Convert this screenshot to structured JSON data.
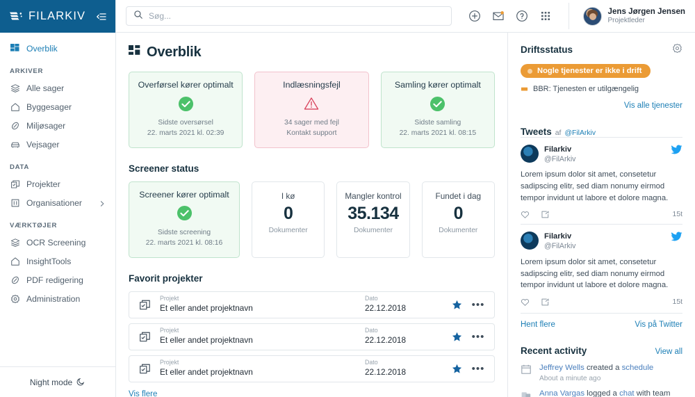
{
  "brand": {
    "name": "FILARKIV",
    "logo_icon": "filarkiv-logo-icon",
    "collapse_icon": "collapse-sidebar-icon"
  },
  "sidebar": {
    "primary": [
      {
        "label": "Overblik",
        "icon": "dashboard-icon",
        "active": true
      }
    ],
    "sections": [
      {
        "title": "ARKIVER",
        "items": [
          {
            "label": "Alle sager",
            "icon": "layers-icon"
          },
          {
            "label": "Byggesager",
            "icon": "home-icon"
          },
          {
            "label": "Miljøsager",
            "icon": "leaf-icon"
          },
          {
            "label": "Vejsager",
            "icon": "car-icon"
          }
        ]
      },
      {
        "title": "DATA",
        "items": [
          {
            "label": "Projekter",
            "icon": "copy-icon"
          },
          {
            "label": "Organisationer",
            "icon": "building-icon",
            "chevron": "chevron-right-icon"
          }
        ]
      },
      {
        "title": "VÆRKTØJER",
        "items": [
          {
            "label": "OCR Screening",
            "icon": "layers-icon"
          },
          {
            "label": "InsightTools",
            "icon": "home-icon"
          },
          {
            "label": "PDF redigering",
            "icon": "leaf-icon"
          },
          {
            "label": "Administration",
            "icon": "gear-icon"
          }
        ]
      }
    ],
    "night_mode": {
      "label": "Night mode",
      "icon": "moon-icon"
    }
  },
  "topbar": {
    "search": {
      "placeholder": "Søg...",
      "value": "",
      "icon": "search-icon"
    },
    "icons": [
      {
        "name": "add-circle-icon"
      },
      {
        "name": "mail-icon"
      },
      {
        "name": "help-circle-icon"
      },
      {
        "name": "apps-grid-icon"
      }
    ],
    "profile": {
      "name": "Jens Jørgen Jensen",
      "role": "Projektleder",
      "avatar": "user-avatar"
    }
  },
  "page": {
    "title": "Overblik",
    "title_icon": "dashboard-icon",
    "settings_icon": "gear-icon"
  },
  "status_cards": [
    {
      "title": "Overførsel kører optimalt",
      "state": "ok",
      "icon": "check-circle-icon",
      "sub1": "Sidste oversørsel",
      "sub2": "22. marts 2021 kl. 02:39"
    },
    {
      "title": "Indlæsningsfejl",
      "state": "error",
      "icon": "warning-triangle-icon",
      "sub1": "34 sager med fejl",
      "sub2": "Kontakt support"
    },
    {
      "title": "Samling kører optimalt",
      "state": "ok",
      "icon": "check-circle-icon",
      "sub1": "Sidste samling",
      "sub2": "22. marts 2021 kl. 08:15"
    }
  ],
  "screener": {
    "heading": "Screener status",
    "status_card": {
      "title": "Screener kører optimalt",
      "icon": "check-circle-icon",
      "sub1": "Sidste screening",
      "sub2": "22. marts 2021 kl. 08:16"
    },
    "metrics": [
      {
        "label": "I kø",
        "value": "0",
        "unit": "Dokumenter"
      },
      {
        "label": "Mangler kontrol",
        "value": "35.134",
        "unit": "Dokumenter"
      },
      {
        "label": "Fundet i dag",
        "value": "0",
        "unit": "Dokumenter"
      }
    ]
  },
  "favorites": {
    "heading": "Favorit projekter",
    "col_project_label": "Projekt",
    "col_date_label": "Dato",
    "rows": [
      {
        "project": "Et eller andet projektnavn",
        "date": "22.12.2018",
        "icon": "project-copy-icon",
        "star": "star-filled-icon",
        "more": "more-horizontal-icon"
      },
      {
        "project": "Et eller andet projektnavn",
        "date": "22.12.2018",
        "icon": "project-copy-icon",
        "star": "star-filled-icon",
        "more": "more-horizontal-icon"
      },
      {
        "project": "Et eller andet projektnavn",
        "date": "22.12.2018",
        "icon": "project-copy-icon",
        "star": "star-filled-icon",
        "more": "more-horizontal-icon"
      }
    ],
    "show_more": "Vis flere"
  },
  "driftsstatus": {
    "heading": "Driftsstatus",
    "badge": "Nogle tjenester er ikke i drift",
    "badge_color": "#eb9b35",
    "service": "BBR: Tjenesten er utilgængelig",
    "service_icon": "flag-icon",
    "link": "Vis alle tjenester"
  },
  "tweets": {
    "heading": "Tweets",
    "heading_suffix": "af",
    "heading_handle": "@FilArkiv",
    "items": [
      {
        "name": "Filarkiv",
        "handle": "@FilArkiv",
        "body": "Lorem ipsum dolor sit amet, consetetur sadipscing elitr, sed diam nonumy eirmod tempor invidunt ut labore et dolore magna.",
        "time": "15t",
        "bird_icon": "twitter-bird-icon",
        "like_icon": "heart-icon",
        "share_icon": "share-icon"
      },
      {
        "name": "Filarkiv",
        "handle": "@FilArkiv",
        "body": "Lorem ipsum dolor sit amet, consetetur sadipscing elitr, sed diam nonumy eirmod tempor invidunt ut labore et dolore magna.",
        "time": "15t",
        "bird_icon": "twitter-bird-icon",
        "like_icon": "heart-icon",
        "share_icon": "share-icon"
      }
    ],
    "load_more": "Hent flere",
    "view_twitter": "Vis på Twitter"
  },
  "recent_activity": {
    "heading": "Recent activity",
    "view_all": "View all",
    "items": [
      {
        "icon": "calendar-icon",
        "user": "Jeffrey Wells",
        "action": " created a ",
        "object": "schedule",
        "tail": "",
        "time": "About a minute ago"
      },
      {
        "icon": "chat-icon",
        "user": "Anna Vargas",
        "action": " logged a ",
        "object": "chat",
        "tail": " with team",
        "time": ""
      }
    ]
  }
}
